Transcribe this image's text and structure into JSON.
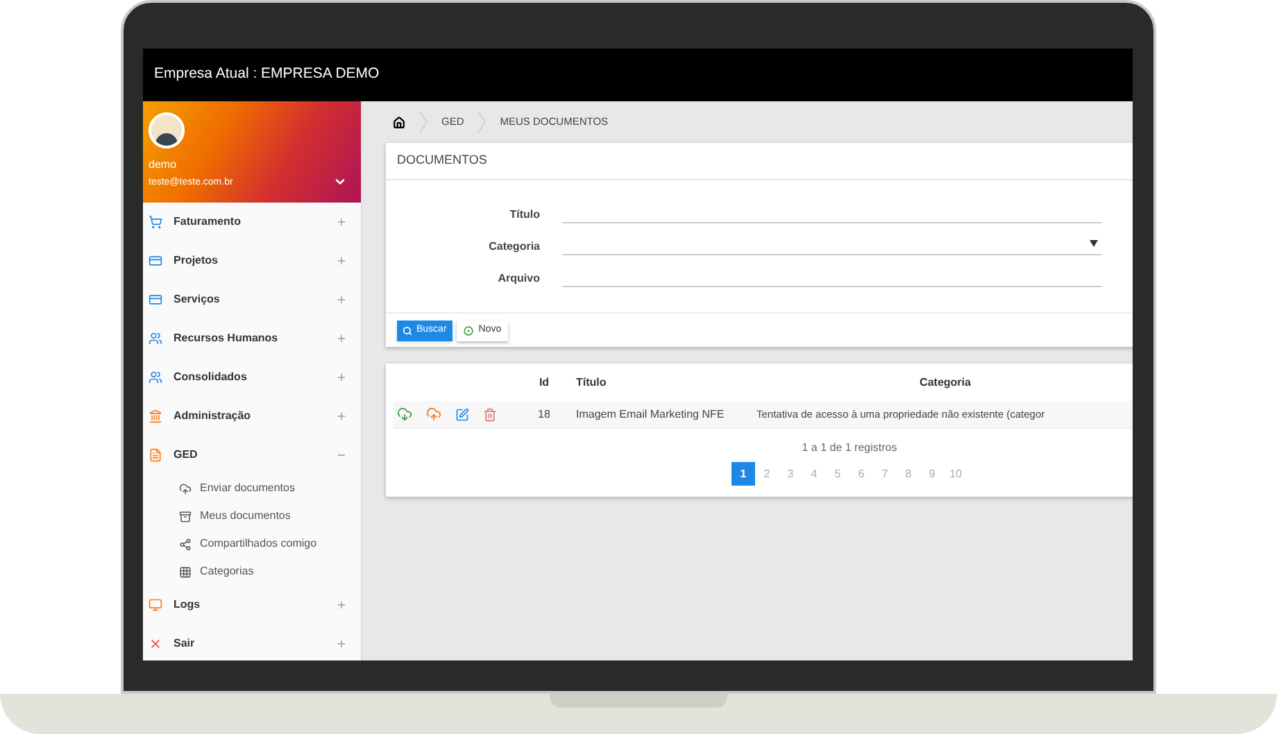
{
  "window": {
    "title": "Empresa Atual : EMPRESA DEMO"
  },
  "sidebar": {
    "user": {
      "name": "demo",
      "email": "teste@teste.com.br"
    },
    "items": [
      {
        "label": "Faturamento",
        "expanded": false
      },
      {
        "label": "Projetos",
        "expanded": false
      },
      {
        "label": "Serviços",
        "expanded": false
      },
      {
        "label": "Recursos Humanos",
        "expanded": false
      },
      {
        "label": "Consolidados",
        "expanded": false
      },
      {
        "label": "Administração",
        "expanded": false
      },
      {
        "label": "GED",
        "expanded": true,
        "children": [
          {
            "label": "Enviar documentos"
          },
          {
            "label": "Meus documentos"
          },
          {
            "label": "Compartilhados comigo"
          },
          {
            "label": "Categorias"
          }
        ]
      },
      {
        "label": "Logs",
        "expanded": false
      },
      {
        "label": "Sair",
        "expanded": false
      }
    ]
  },
  "breadcrumb": [
    "GED",
    "MEUS DOCUMENTOS"
  ],
  "search_card": {
    "title": "DOCUMENTOS",
    "fields": [
      {
        "label": "Título",
        "kind": "text"
      },
      {
        "label": "Categoria",
        "kind": "select"
      },
      {
        "label": "Arquivo",
        "kind": "text"
      }
    ],
    "buttons": [
      {
        "label": "Buscar",
        "kind": "primary"
      },
      {
        "label": "Novo",
        "kind": "default"
      }
    ]
  },
  "table": {
    "columns": [
      "Id",
      "Título",
      "Categoria"
    ],
    "rows": [
      {
        "cells": [
          "18",
          "Imagem Email Marketing NFE",
          "Tentativa de acesso à uma propriedade não existente (categor"
        ]
      }
    ],
    "summary": "1 a 1 de 1 registros",
    "pages": [
      {
        "label": "1",
        "selected": true
      },
      {
        "label": "2",
        "selected": false
      },
      {
        "label": "3",
        "selected": false
      },
      {
        "label": "4",
        "selected": false
      },
      {
        "label": "5",
        "selected": false
      },
      {
        "label": "6",
        "selected": false
      },
      {
        "label": "7",
        "selected": false
      },
      {
        "label": "8",
        "selected": false
      },
      {
        "label": "9",
        "selected": false
      },
      {
        "label": "10",
        "selected": false
      }
    ]
  }
}
